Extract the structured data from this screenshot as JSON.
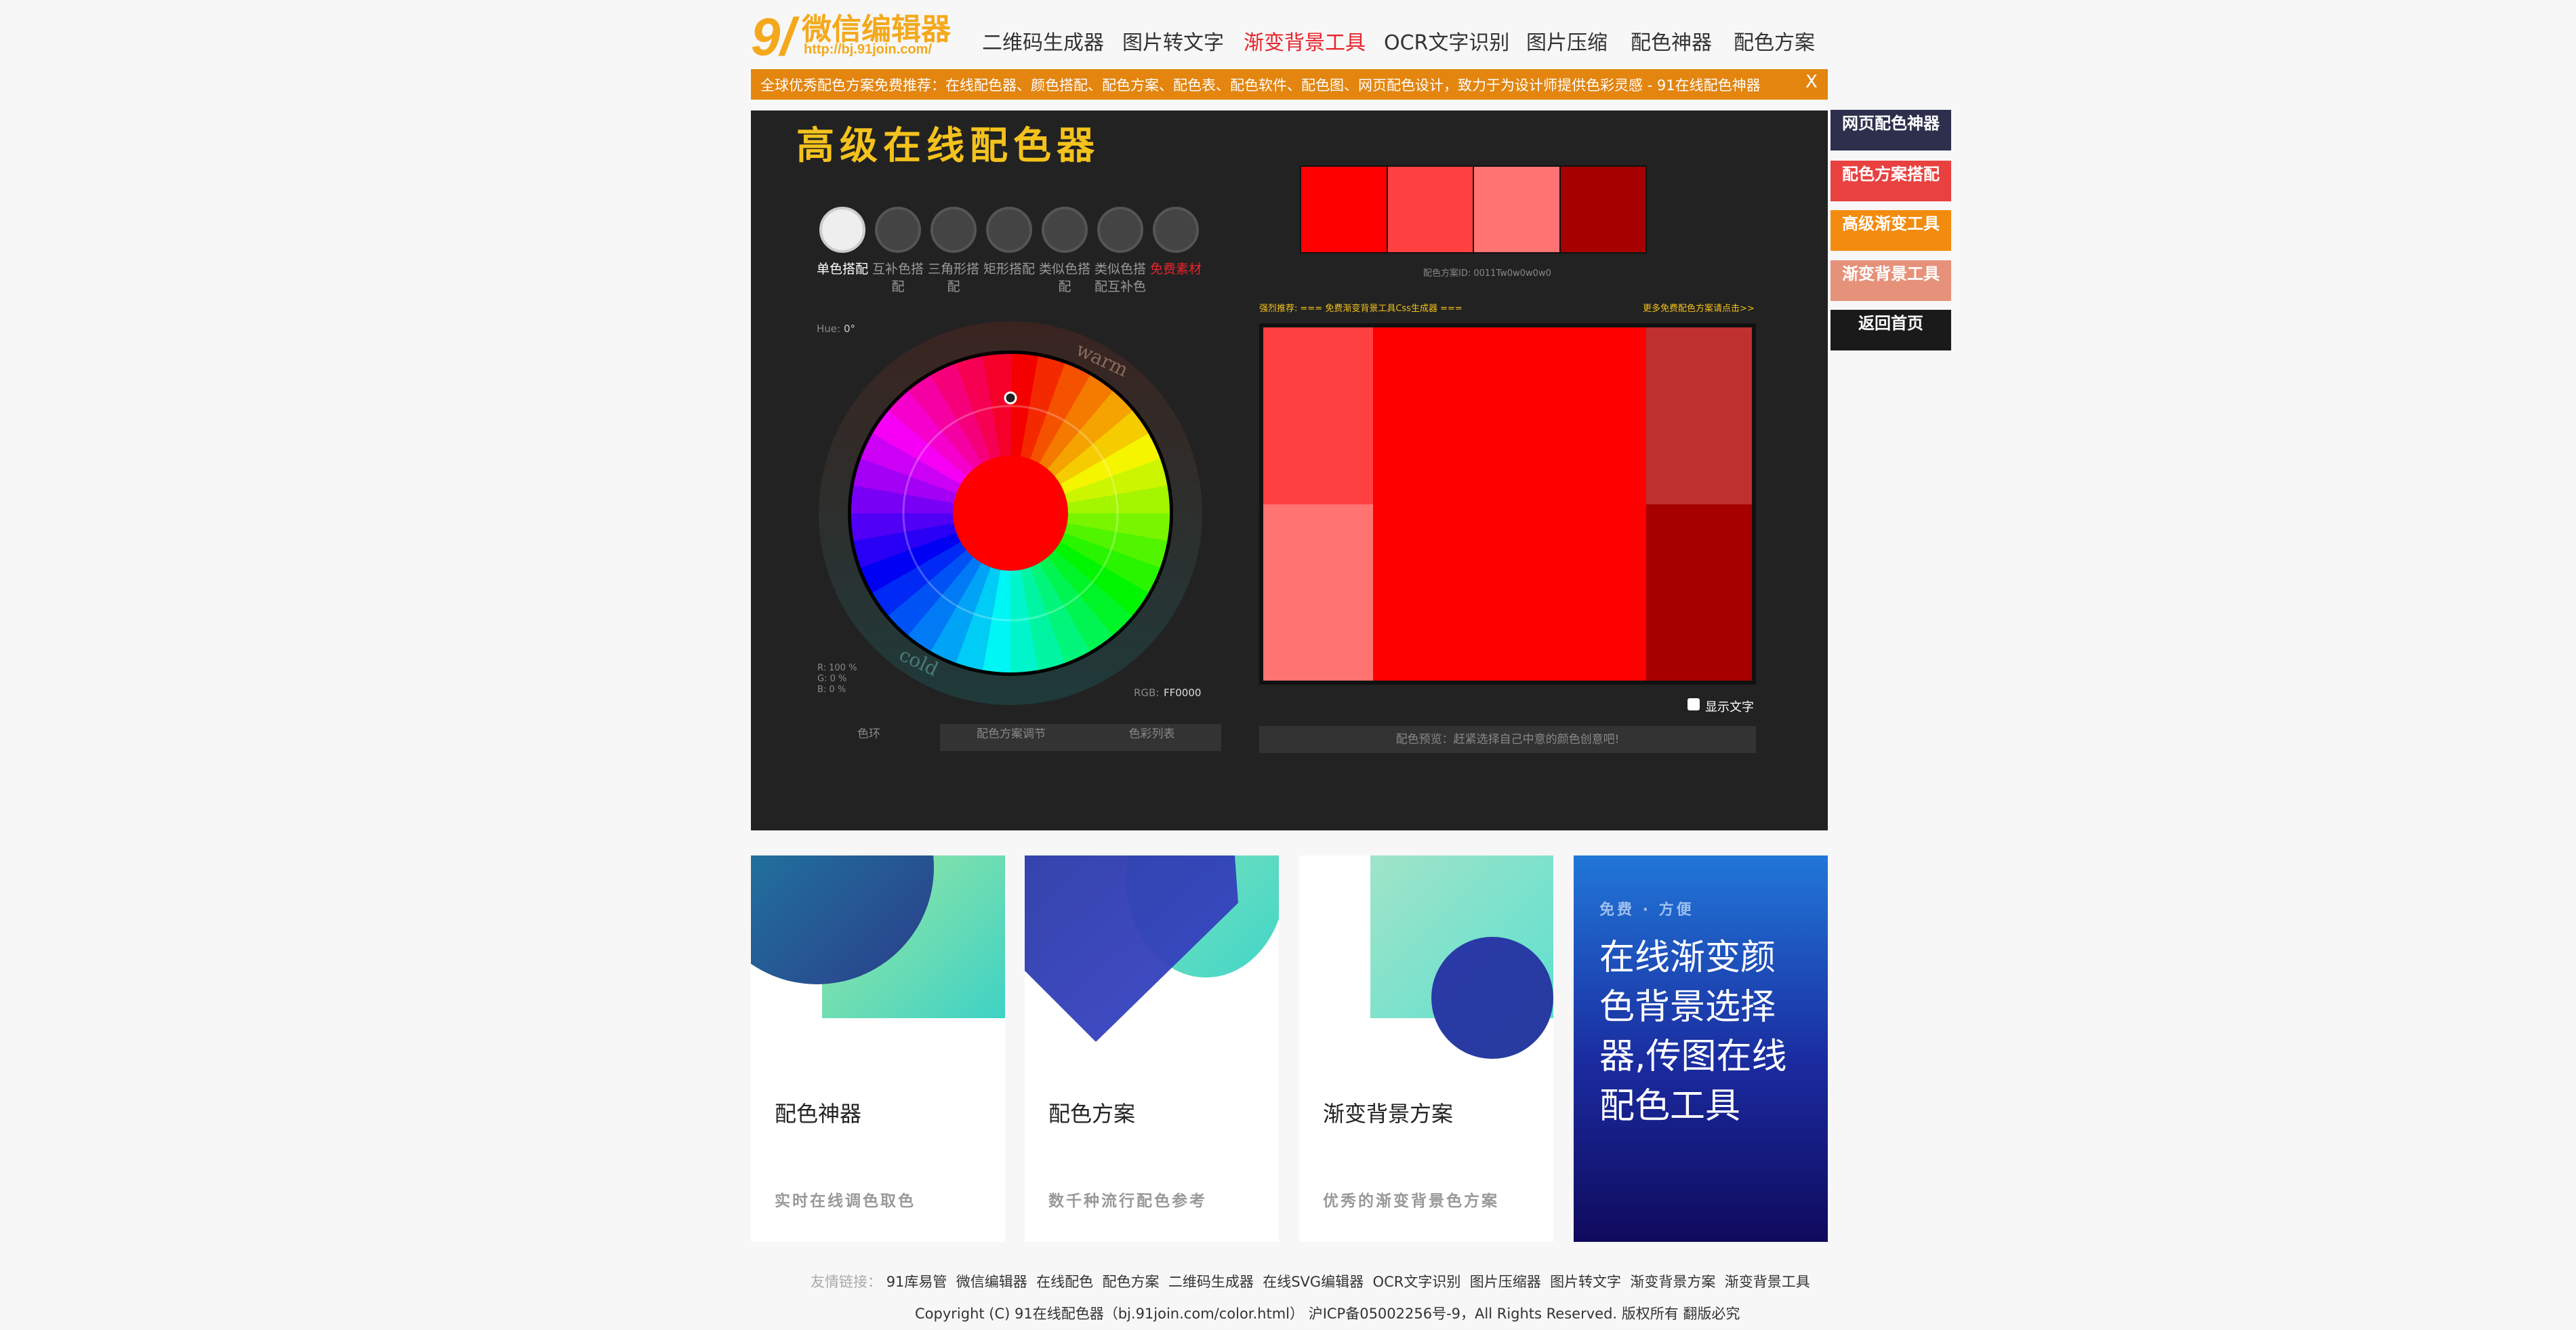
{
  "header": {
    "logo_num": "9/",
    "logo_title": "微信编辑器",
    "logo_url": "http://bj.91join.com/",
    "nav": [
      "二维码生成器",
      "图片转文字",
      "渐变背景工具",
      "OCR文字识别",
      "图片压缩",
      "配色神器",
      "配色方案"
    ]
  },
  "banner": {
    "text": "全球优秀配色方案免费推荐：在线配色器、颜色搭配、配色方案、配色表、配色软件、配色图、网页配色设计，致力于为设计师提供色彩灵感 - 91在线配色神器",
    "close": "X"
  },
  "tool": {
    "title": "高级在线配色器",
    "schemes": [
      "单色搭配",
      "互补色搭配",
      "三角形搭配",
      "矩形搭配",
      "类似色搭配",
      "类似色搭配互补色",
      "免费素材"
    ],
    "hue_label": "Hue:",
    "hue_value": "0°",
    "warm": "warm",
    "cold": "cold",
    "rgb_r": "R: 100 %",
    "rgb_g": "G:   0 %",
    "rgb_b": "B:   0 %",
    "rgb_label": "RGB:",
    "rgb_value": "FF0000",
    "palette": [
      "#ff0000",
      "#ff4040",
      "#ff7373",
      "#a60000"
    ],
    "scheme_id": "配色方案ID: 0011Tw0w0w0w0",
    "recommend": "强烈推荐: === 免费渐变背景工具Css生成器 ===",
    "more": "更多免费配色方案请点击>>",
    "preview_colors": {
      "top_left": "#ff4040",
      "bottom_left": "#ff7373",
      "center": "#ff0000",
      "top_right": "#bf3030",
      "bottom_right": "#a60000"
    },
    "show_text": "显示文字",
    "tabs": [
      "色环",
      "配色方案调节",
      "色彩列表"
    ],
    "preview_hint": "配色预览：赶紧选择自己中意的颜色创意吧!"
  },
  "side_buttons": [
    {
      "label": "网页配色神器",
      "color": "#2d2f4d"
    },
    {
      "label": "配色方案搭配",
      "color": "#e8413f"
    },
    {
      "label": "高级渐变工具",
      "color": "#f38b0e"
    },
    {
      "label": "渐变背景工具",
      "color": "#e6927a"
    },
    {
      "label": "返回首页",
      "color": "#1a1a1a"
    }
  ],
  "cards": [
    {
      "title": "配色神器",
      "sub": "实时在线调色取色"
    },
    {
      "title": "配色方案",
      "sub": "数千种流行配色参考"
    },
    {
      "title": "渐变背景方案",
      "sub": "优秀的渐变背景色方案"
    }
  ],
  "promo": {
    "tag": "免费 · 方便",
    "text": "在线渐变颜色背景选择器,传图在线配色工具"
  },
  "footer": {
    "links_label": "友情链接：",
    "links": [
      "91库易管",
      "微信编辑器",
      "在线配色",
      "配色方案",
      "二维码生成器",
      "在线SVG编辑器",
      "OCR文字识别",
      "图片压缩器",
      "图片转文字",
      "渐变背景方案",
      "渐变背景工具"
    ],
    "copyright": "Copyright (C) 91在线配色器（bj.91join.com/color.html） 沪ICP备05002256号-9，All Rights Reserved. 版权所有 翻版必究"
  }
}
